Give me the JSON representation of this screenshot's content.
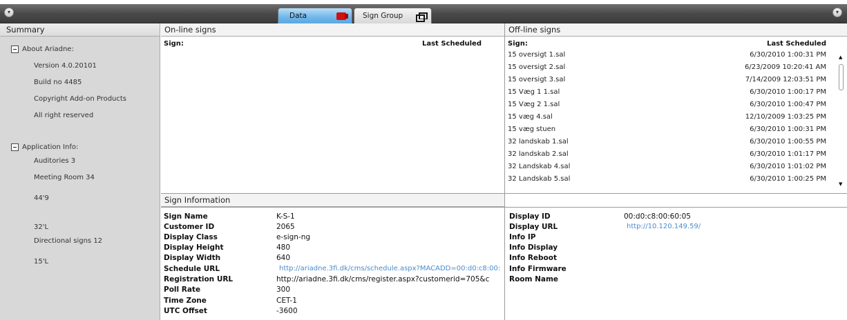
{
  "tabs": [
    {
      "label": "Data",
      "icon": "media-icon",
      "active": true
    },
    {
      "label": "Sign Group",
      "icon": "window-icon",
      "active": false
    }
  ],
  "summary": {
    "title": "Summary",
    "sections": [
      {
        "title": "About Ariadne:",
        "items": [
          "Version 4.0.20101",
          "Build no 4485",
          "Copyright Add-on Products",
          "All right reserved"
        ]
      },
      {
        "title": "Application Info:",
        "items": [
          "Auditories 3",
          "Meeting Room 34",
          "44'9",
          "32'L",
          "Directional signs 12",
          "15'L"
        ]
      }
    ]
  },
  "online": {
    "title": "On-line signs",
    "col_sign": "Sign:",
    "col_last": "Last Scheduled"
  },
  "offline": {
    "title": "Off-line signs",
    "col_sign": "Sign:",
    "col_last": "Last Scheduled",
    "rows": [
      {
        "name": "15 oversigt 1.sal",
        "date": "6/30/2010 1:00:31 PM"
      },
      {
        "name": "15 oversigt 2.sal",
        "date": "6/23/2009 10:20:41 AM"
      },
      {
        "name": "15 oversigt 3.sal",
        "date": "7/14/2009 12:03:51 PM"
      },
      {
        "name": "15 Væg 1 1.sal",
        "date": "6/30/2010 1:00:17 PM"
      },
      {
        "name": "15 Væg 2 1.sal",
        "date": "6/30/2010 1:00:47 PM"
      },
      {
        "name": "15 væg 4.sal",
        "date": "12/10/2009 1:03:25 PM"
      },
      {
        "name": "15 væg stuen",
        "date": "6/30/2010 1:00:31 PM"
      },
      {
        "name": "32 landskab 1.sal",
        "date": "6/30/2010 1:00:55 PM"
      },
      {
        "name": "32 landskab 2.sal",
        "date": "6/30/2010 1:01:17 PM"
      },
      {
        "name": "32 Landskab 4.sal",
        "date": "6/30/2010 1:01:02 PM"
      },
      {
        "name": "32 Landskab 5.sal",
        "date": "6/30/2010 1:00:25 PM"
      }
    ]
  },
  "sign_info": {
    "title": "Sign Information",
    "left": [
      {
        "label": "Sign Name",
        "value": "K-S-1"
      },
      {
        "label": "Customer ID",
        "value": "2065"
      },
      {
        "label": "Display Class",
        "value": "e-sign-ng"
      },
      {
        "label": "Display Height",
        "value": "480"
      },
      {
        "label": "Display Width",
        "value": "640"
      },
      {
        "label": "Schedule URL",
        "value": "http://ariadne.3fi.dk/cms/schedule.aspx?MACADD=00:d0:c8:00:"
      },
      {
        "label": "Registration URL",
        "value": "http://ariadne.3fi.dk/cms/register.aspx?customerid=705&c"
      },
      {
        "label": "Poll Rate",
        "value": "300"
      },
      {
        "label": "Time Zone",
        "value": "CET-1"
      },
      {
        "label": "UTC Offset",
        "value": "-3600"
      }
    ],
    "right": [
      {
        "label": "Display ID",
        "value": "00:d0:c8:00:60:05"
      },
      {
        "label": "Display URL",
        "value": "http://10.120.149.59/"
      },
      {
        "label": "Info IP",
        "value": ""
      },
      {
        "label": "Info Display",
        "value": ""
      },
      {
        "label": "Info Reboot",
        "value": ""
      },
      {
        "label": "Info Firmware",
        "value": ""
      },
      {
        "label": "Room Name",
        "value": ""
      }
    ]
  },
  "colors": {
    "accent_tab": "#6fb6ea",
    "link": "#4a8ccb",
    "summary_bg": "#d8d8d8",
    "topbar": "#4a4a4a"
  }
}
